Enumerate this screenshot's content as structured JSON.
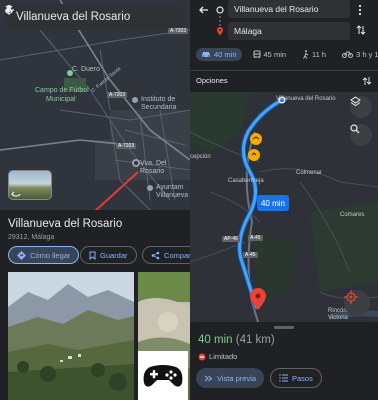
{
  "left": {
    "search": {
      "value": "Villanueva del Rosario"
    },
    "map": {
      "labels": [
        "C. Duero",
        "Campo de Fútbol",
        "Municipal",
        "Instituto de",
        "Secundaria",
        "Vva. Del Rosario",
        "Ayuntam",
        "Villanueva",
        "C. Fuente Santa"
      ],
      "roads": [
        "A-7203",
        "A-7203",
        "A-7203"
      ]
    },
    "place": {
      "title": "Villanueva del Rosario",
      "subtitle": "29312, Málaga",
      "directions_label": "Cómo llegar",
      "save_label": "Guardar",
      "share_label": "Compar"
    }
  },
  "right": {
    "origin": "Villanueva del Rosario",
    "destination": "Málaga",
    "modes": [
      {
        "label": "40 min",
        "icon": "car-icon"
      },
      {
        "label": "45 min",
        "icon": "bus-icon"
      },
      {
        "label": "11 h",
        "icon": "walk-icon"
      },
      {
        "label": "3 h y 18",
        "icon": "bike-icon"
      }
    ],
    "options_label": "Opciones",
    "map": {
      "labels": [
        "Villanueva del Rosario",
        "Casabermeja",
        "Colmenar",
        "Comares",
        "cepción",
        "Rincón de la Victoria"
      ],
      "roads": [
        "A-45",
        "A-45",
        "AP-46"
      ],
      "time_badge": "40 min"
    },
    "summary": {
      "time": "40 min",
      "distance": "(41 km)",
      "restriction": "Limitado",
      "preview_label": "Vista previa",
      "steps_label": "Pasos"
    }
  },
  "colors": {
    "accent": "#8ab4f8",
    "route": "#4aa3f0",
    "time_green": "#81c995",
    "pin_red": "#ea4335"
  }
}
